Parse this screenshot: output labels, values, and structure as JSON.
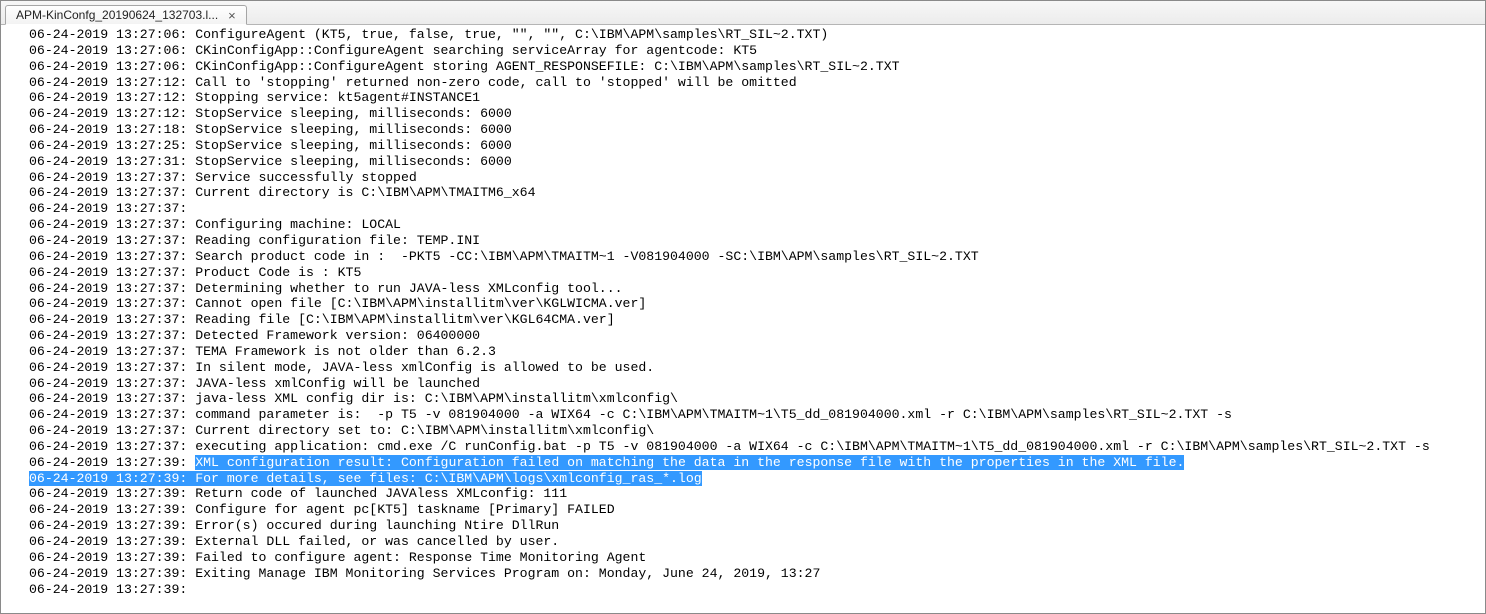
{
  "tab": {
    "title": "APM-KinConfg_20190624_132703.l...",
    "close_label": "×"
  },
  "log": {
    "lines": [
      {
        "text": "06-24-2019 13:27:06: ConfigureAgent (KT5, true, false, true, \"\", \"\", C:\\IBM\\APM\\samples\\RT_SIL~2.TXT)",
        "sel": false
      },
      {
        "text": "06-24-2019 13:27:06: CKinConfigApp::ConfigureAgent searching serviceArray for agentcode: KT5",
        "sel": false
      },
      {
        "text": "06-24-2019 13:27:06: CKinConfigApp::ConfigureAgent storing AGENT_RESPONSEFILE: C:\\IBM\\APM\\samples\\RT_SIL~2.TXT",
        "sel": false
      },
      {
        "text": "06-24-2019 13:27:12: Call to 'stopping' returned non-zero code, call to 'stopped' will be omitted",
        "sel": false
      },
      {
        "text": "06-24-2019 13:27:12: Stopping service: kt5agent#INSTANCE1",
        "sel": false
      },
      {
        "text": "06-24-2019 13:27:12: StopService sleeping, milliseconds: 6000",
        "sel": false
      },
      {
        "text": "06-24-2019 13:27:18: StopService sleeping, milliseconds: 6000",
        "sel": false
      },
      {
        "text": "06-24-2019 13:27:25: StopService sleeping, milliseconds: 6000",
        "sel": false
      },
      {
        "text": "06-24-2019 13:27:31: StopService sleeping, milliseconds: 6000",
        "sel": false
      },
      {
        "text": "06-24-2019 13:27:37: Service successfully stopped",
        "sel": false
      },
      {
        "text": "06-24-2019 13:27:37: Current directory is C:\\IBM\\APM\\TMAITM6_x64",
        "sel": false
      },
      {
        "text": "06-24-2019 13:27:37:",
        "sel": false
      },
      {
        "text": "06-24-2019 13:27:37: Configuring machine: LOCAL",
        "sel": false
      },
      {
        "text": "06-24-2019 13:27:37: Reading configuration file: TEMP.INI",
        "sel": false
      },
      {
        "text": "06-24-2019 13:27:37: Search product code in :  -PKT5 -CC:\\IBM\\APM\\TMAITM~1 -V081904000 -SC:\\IBM\\APM\\samples\\RT_SIL~2.TXT",
        "sel": false
      },
      {
        "text": "06-24-2019 13:27:37: Product Code is : KT5",
        "sel": false
      },
      {
        "text": "06-24-2019 13:27:37: Determining whether to run JAVA-less XMLconfig tool...",
        "sel": false
      },
      {
        "text": "06-24-2019 13:27:37: Cannot open file [C:\\IBM\\APM\\installitm\\ver\\KGLWICMA.ver]",
        "sel": false
      },
      {
        "text": "06-24-2019 13:27:37: Reading file [C:\\IBM\\APM\\installitm\\ver\\KGL64CMA.ver]",
        "sel": false
      },
      {
        "text": "06-24-2019 13:27:37: Detected Framework version: 06400000",
        "sel": false
      },
      {
        "text": "06-24-2019 13:27:37: TEMA Framework is not older than 6.2.3",
        "sel": false
      },
      {
        "text": "06-24-2019 13:27:37: In silent mode, JAVA-less xmlConfig is allowed to be used.",
        "sel": false
      },
      {
        "text": "06-24-2019 13:27:37: JAVA-less xmlConfig will be launched",
        "sel": false
      },
      {
        "text": "06-24-2019 13:27:37: java-less XML config dir is: C:\\IBM\\APM\\installitm\\xmlconfig\\",
        "sel": false
      },
      {
        "text": "06-24-2019 13:27:37: command parameter is:  -p T5 -v 081904000 -a WIX64 -c C:\\IBM\\APM\\TMAITM~1\\T5_dd_081904000.xml -r C:\\IBM\\APM\\samples\\RT_SIL~2.TXT -s",
        "sel": false
      },
      {
        "text": "06-24-2019 13:27:37: Current directory set to: C:\\IBM\\APM\\installitm\\xmlconfig\\",
        "sel": false
      },
      {
        "text": "06-24-2019 13:27:37: executing application: cmd.exe /C runConfig.bat -p T5 -v 081904000 -a WIX64 -c C:\\IBM\\APM\\TMAITM~1\\T5_dd_081904000.xml -r C:\\IBM\\APM\\samples\\RT_SIL~2.TXT -s",
        "sel": false
      },
      {
        "prefix": "06-24-2019 13:27:39: ",
        "text": "XML configuration result: Configuration failed on matching the data in the response file with the properties in the XML file.",
        "sel": true
      },
      {
        "text": "06-24-2019 13:27:39: For more details, see files: C:\\IBM\\APM\\logs\\xmlconfig_ras_*.log",
        "sel": true
      },
      {
        "text": "06-24-2019 13:27:39: Return code of launched JAVAless XMLconfig: 111",
        "sel": false
      },
      {
        "text": "06-24-2019 13:27:39: Configure for agent pc[KT5] taskname [Primary] FAILED",
        "sel": false
      },
      {
        "text": "06-24-2019 13:27:39: Error(s) occured during launching Ntire DllRun",
        "sel": false
      },
      {
        "text": "06-24-2019 13:27:39: External DLL failed, or was cancelled by user.",
        "sel": false
      },
      {
        "text": "06-24-2019 13:27:39: Failed to configure agent: Response Time Monitoring Agent",
        "sel": false
      },
      {
        "text": "06-24-2019 13:27:39: Exiting Manage IBM Monitoring Services Program on: Monday, June 24, 2019, 13:27",
        "sel": false
      },
      {
        "text": "06-24-2019 13:27:39:",
        "sel": false
      }
    ]
  }
}
